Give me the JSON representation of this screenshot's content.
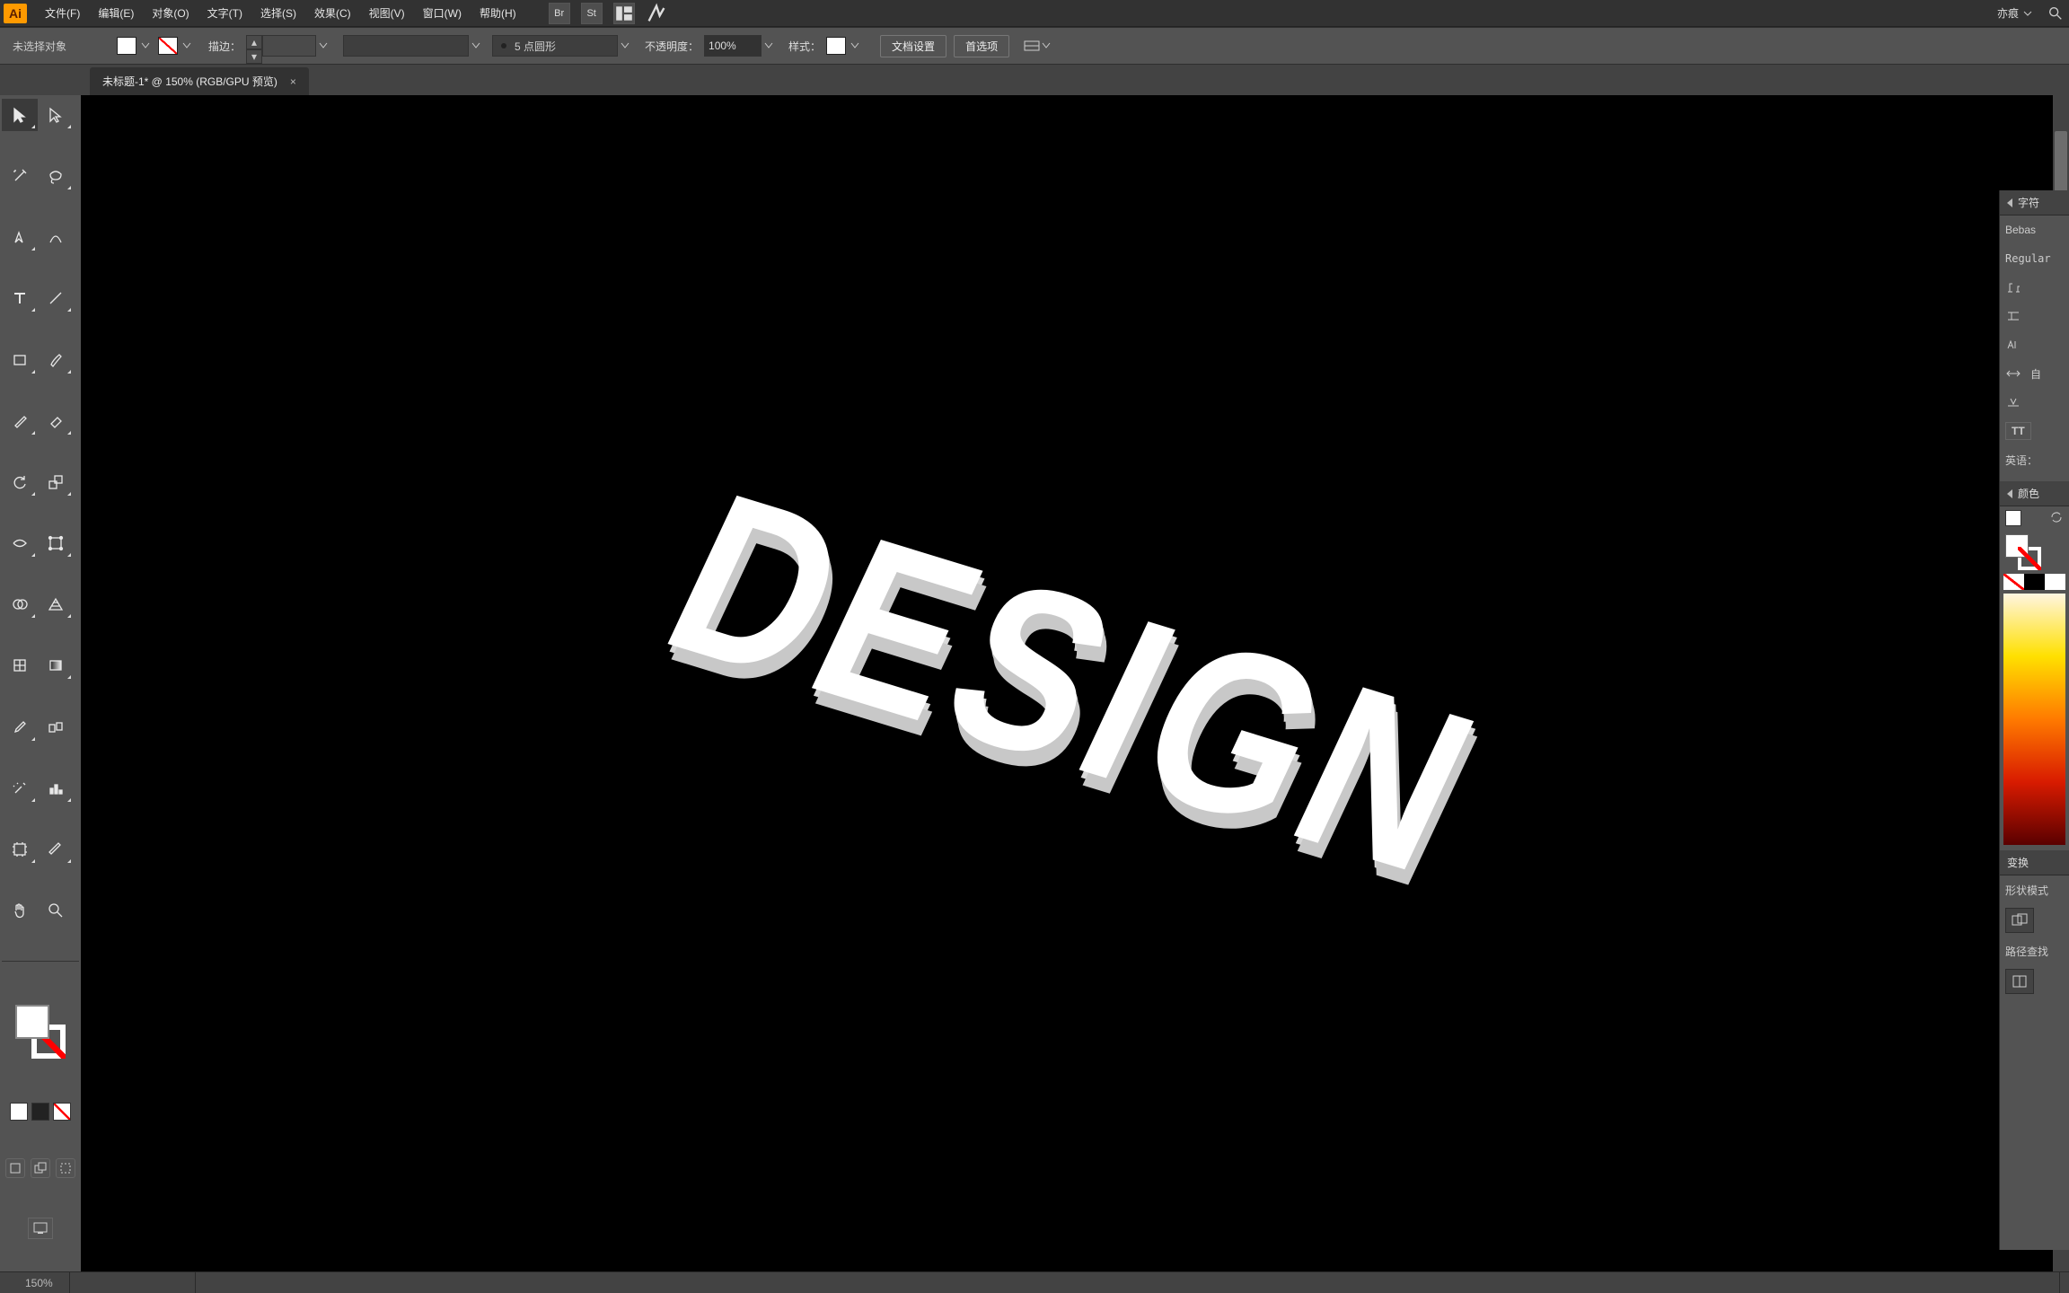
{
  "menubar": {
    "items": [
      "文件(F)",
      "编辑(E)",
      "对象(O)",
      "文字(T)",
      "选择(S)",
      "效果(C)",
      "视图(V)",
      "窗口(W)",
      "帮助(H)"
    ],
    "bridge_icon": "Br",
    "stock_icon": "St",
    "user_label": "亦痕"
  },
  "ctrlbar": {
    "no_selection": "未选择对象",
    "stroke_label": "描边：",
    "stroke_weight": "",
    "stroke_profile": "5 点圆形",
    "opacity_label": "不透明度：",
    "opacity_value": "100%",
    "style_label": "样式：",
    "doc_setup_btn": "文档设置",
    "prefs_btn": "首选项"
  },
  "doc_tab": {
    "title": "未标题-1* @ 150% (RGB/GPU 预览)",
    "close": "×"
  },
  "artboard": {
    "text": "DESIGN"
  },
  "status": {
    "zoom": "150%"
  },
  "rpanels": {
    "char_title": "字符",
    "font_family": "Bebas",
    "font_style": "Regular",
    "tt_label": "TT",
    "lang_label": "英语：",
    "color_title": "颜色",
    "transform_title": "变换",
    "shape_mode_label": "形状模式",
    "pathfinder_label": "路径查找"
  },
  "tool_names": [
    "selection-tool",
    "direct-selection-tool",
    "magic-wand-tool",
    "lasso-tool",
    "pen-tool",
    "curvature-tool",
    "type-tool",
    "line-tool",
    "rectangle-tool",
    "paintbrush-tool",
    "shaper-tool",
    "eraser-tool",
    "rotate-tool",
    "scale-tool",
    "width-tool",
    "free-transform-tool",
    "shape-builder-tool",
    "perspective-grid-tool",
    "mesh-tool",
    "gradient-tool",
    "eyedropper-tool",
    "blend-tool",
    "symbol-sprayer-tool",
    "column-graph-tool",
    "artboard-tool",
    "slice-tool",
    "hand-tool",
    "zoom-tool"
  ]
}
